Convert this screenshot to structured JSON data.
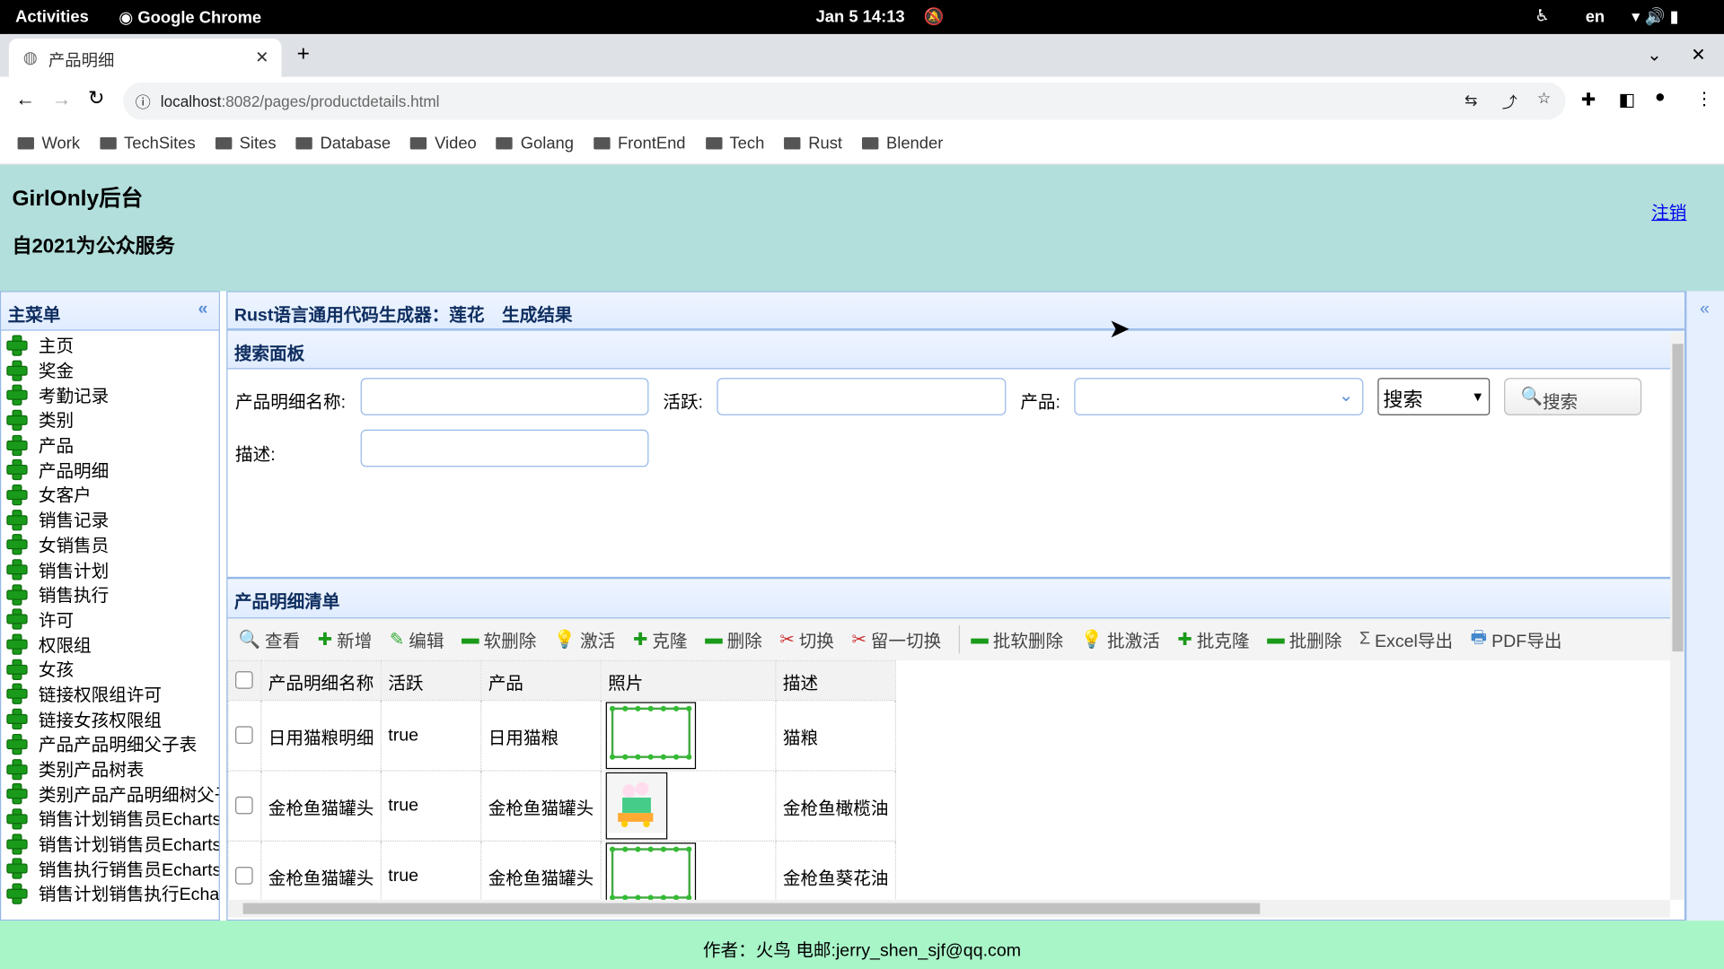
{
  "os": {
    "activities": "Activities",
    "app": "Google Chrome",
    "datetime": "Jan 5  14:13",
    "lang": "en"
  },
  "browser": {
    "tab_title": "产品明细",
    "url_host": "localhost",
    "url_rest": ":8082/pages/productdetails.html",
    "bookmarks": [
      "Work",
      "TechSites",
      "Sites",
      "Database",
      "Video",
      "Golang",
      "FrontEnd",
      "Tech",
      "Rust",
      "Blender"
    ]
  },
  "header": {
    "title": "GirlOnly后台",
    "subtitle": "自2021为公众服务",
    "logout": "注销"
  },
  "sidebar": {
    "title": "主菜单",
    "items": [
      "主页",
      "奖金",
      "考勤记录",
      "类别",
      "产品",
      "产品明细",
      "女客户",
      "销售记录",
      "女销售员",
      "销售计划",
      "销售执行",
      "许可",
      "权限组",
      "女孩",
      "链接权限组许可",
      "链接女孩权限组",
      "产品产品明细父子表",
      "类别产品树表",
      "类别产品产品明细树父子表",
      "销售计划销售员Echarts",
      "销售计划销售员Echarts",
      "销售执行销售员Echarts",
      "销售计划销售执行Echarts"
    ]
  },
  "main": {
    "title": "Rust语言通用代码生成器：莲花　生成结果",
    "search": {
      "title": "搜索面板",
      "name_label": "产品明细名称:",
      "active_label": "活跃:",
      "product_label": "产品:",
      "desc_label": "描述:",
      "mode": "搜索",
      "search_button": "搜索"
    },
    "list": {
      "title": "产品明细清单",
      "toolbar": [
        {
          "icon": "search-icon",
          "label": "查看"
        },
        {
          "icon": "plus-icon",
          "label": "新增"
        },
        {
          "icon": "pencil-icon",
          "label": "编辑"
        },
        {
          "icon": "minus-icon",
          "label": "软删除"
        },
        {
          "icon": "bulb-icon",
          "label": "激活"
        },
        {
          "icon": "plus-icon",
          "label": "克隆"
        },
        {
          "icon": "minus-icon",
          "label": "删除"
        },
        {
          "icon": "scissors-icon",
          "label": "切换"
        },
        {
          "icon": "scissors-icon",
          "label": "留一切换"
        },
        {
          "icon": "minus-icon",
          "label": "批软删除"
        },
        {
          "icon": "bulb-icon",
          "label": "批激活"
        },
        {
          "icon": "plus-icon",
          "label": "批克隆"
        },
        {
          "icon": "minus-icon",
          "label": "批删除"
        },
        {
          "icon": "sigma-icon",
          "label": "Excel导出"
        },
        {
          "icon": "printer-icon",
          "label": "PDF导出"
        }
      ],
      "columns": [
        "产品明细名称",
        "活跃",
        "产品",
        "照片",
        "描述"
      ],
      "rows": [
        {
          "name": "日用猫粮明细",
          "active": "true",
          "product": "日用猫粮",
          "photo": "vine-frame",
          "desc": "猫粮"
        },
        {
          "name": "金枪鱼猫罐头",
          "active": "true",
          "product": "金枪鱼猫罐头",
          "photo": "cartoon-kids",
          "desc": "金枪鱼橄榄油"
        },
        {
          "name": "金枪鱼猫罐头",
          "active": "true",
          "product": "金枪鱼猫罐头",
          "photo": "vine-frame",
          "desc": "金枪鱼葵花油"
        }
      ]
    }
  },
  "footer": {
    "text": "作者：火鸟 电邮:jerry_shen_sjf@qq.com"
  },
  "colors": {
    "header_bg": "#b2dfdb",
    "footer_bg": "#a8f5c8",
    "panel_border": "#95b8e7",
    "panel_title": "#0e2d5f"
  }
}
